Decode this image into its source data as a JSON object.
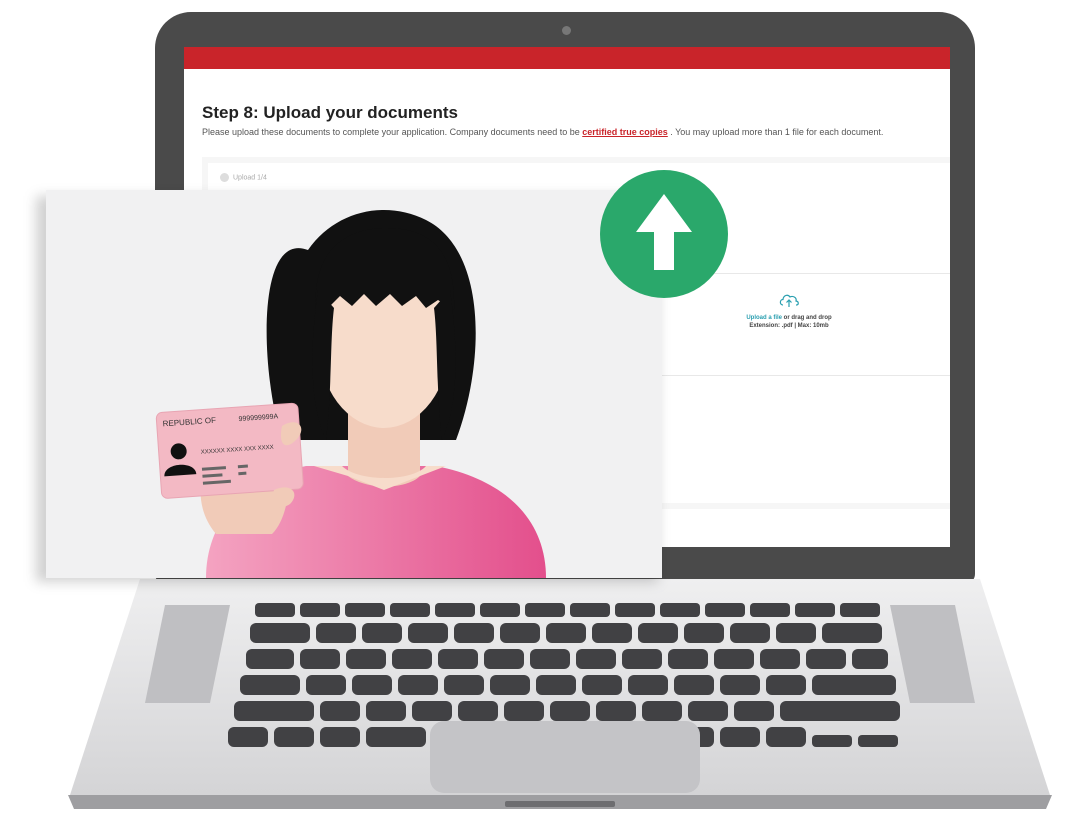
{
  "screen": {
    "title": "Step 8: Upload your documents",
    "description_before": "Please upload these documents to complete your application. Company documents need to be ",
    "description_link": "certified true copies",
    "description_after": " . You may upload more than 1 file for each document.",
    "progress_label": "Upload 1/4",
    "dropzone": {
      "link_text": "Upload a file",
      "text_after_link": " or drag and drop",
      "extension_line": "Extension: .pdf | Max: 10mb"
    }
  },
  "id_card": {
    "header": "REPUBLIC OF",
    "number": "999999999A",
    "name": "XXXXXX XXXX XXX XXXX"
  },
  "colors": {
    "brand_red": "#c9242a",
    "upload_badge_green": "#2aa86b",
    "shirt_pink": "#e8679a",
    "id_card_pink": "#f3b9c4",
    "hair": "#111111",
    "skin": "#f7dccb"
  },
  "icons": [
    "camera-icon",
    "cloud-upload-icon",
    "upload-arrow-icon",
    "avatar-silhouette-icon"
  ]
}
